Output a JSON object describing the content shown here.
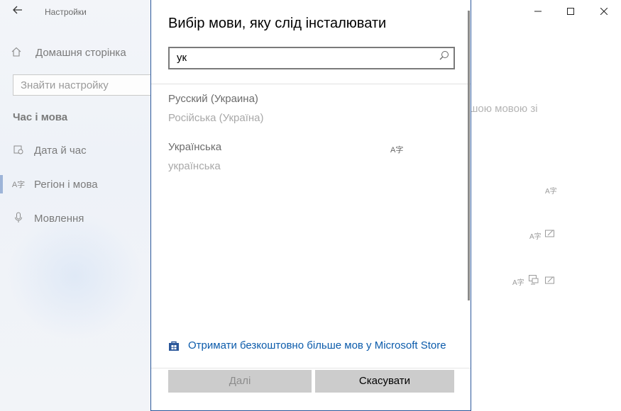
{
  "app": {
    "title": "Настройки",
    "back_icon": "arrow-left-icon"
  },
  "window_controls": {
    "minimize": "—",
    "maximize": "☐",
    "close": "✕"
  },
  "nav": {
    "home_label": "Домашня сторінка",
    "search_placeholder": "Знайти настройку",
    "section_title": "Час і мова",
    "items": [
      {
        "label": "Дата й час",
        "icon": "calendar-clock-icon",
        "glyph": "▦"
      },
      {
        "label": "Регіон і мова",
        "icon": "language-icon",
        "glyph": "A字"
      },
      {
        "label": "Мовлення",
        "icon": "microphone-icon",
        "glyph": "🎙"
      }
    ],
    "active_index": 1
  },
  "background": {
    "partial_text": "ршою мовою зі"
  },
  "dialog": {
    "title": "Вибір мови, яку слід інсталювати",
    "search_value": "ук",
    "languages": [
      {
        "native": "Русский (Украина)",
        "localized": "Російська (Україна)"
      },
      {
        "native": "Українська",
        "localized": "українська"
      }
    ],
    "store_link": "Отримати безкоштовно більше мов у Microsoft Store",
    "next_label": "Далі",
    "cancel_label": "Скасувати"
  },
  "colors": {
    "accent": "#2b579a",
    "link": "#0b5bab",
    "button": "#cccccc"
  }
}
